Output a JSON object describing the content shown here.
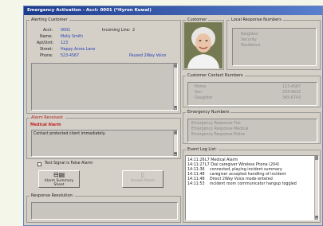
{
  "window": {
    "title": "Emergency Activation - Acct: 0001  (*Hyron Kuwal)"
  },
  "alerting_customer": {
    "label": "Alerting Customer",
    "incoming_line_label": "Incoming Line:",
    "incoming_line_value": "2",
    "fields": [
      {
        "label": "Acct:",
        "value": "0001"
      },
      {
        "label": "Name:",
        "value": "Molly Smith"
      },
      {
        "label": "Apt/Unit:",
        "value": "123"
      },
      {
        "label": "Street:",
        "value": "Happy Acres Lane"
      },
      {
        "label": "Phone:",
        "value": "523-4567"
      }
    ],
    "status": "Paused 2Way Voice"
  },
  "alarm_received": {
    "label": "Alarm Received:",
    "alarm_name": "Medical Alarm",
    "instruction": "Contact protected client immediately."
  },
  "false_alarm": {
    "label": "Test Signal is False Alarm"
  },
  "buttons": {
    "summary": "Alarm Summary Sheet",
    "accept": "Accept Alarm"
  },
  "response_resolution": {
    "label": "Response Resolution:"
  },
  "customer": {
    "label": "Customer"
  },
  "local_response": {
    "label": "Local Response Numbers",
    "items": [
      "Neighbor",
      "Security",
      "Residence"
    ]
  },
  "contact_numbers": {
    "label": "Customer Contact Numbers",
    "rows": [
      {
        "name": "Home",
        "number": "123-4567"
      },
      {
        "name": "Son",
        "number": "234-5632"
      },
      {
        "name": "Daughter",
        "number": "345-6743"
      }
    ]
  },
  "emergency_numbers": {
    "label": "Emergency Numbers",
    "items": [
      "Emergency Response Fire",
      "Emergency Response Medical",
      "Emergency Response Police"
    ]
  },
  "event_log": {
    "label": "Event Log List:",
    "entries": [
      {
        "time": "14:11:26",
        "text": "L7 Medical Alarm"
      },
      {
        "time": "14:11:27",
        "text": "L7 Dial caregiver Wireless Phone (204)"
      },
      {
        "time": "14:11:36",
        "text": "connected, playing incident summary"
      },
      {
        "time": "14:11:48",
        "text": "caregiver accepted handling of incident"
      },
      {
        "time": "14:11:48",
        "text": "Direct 2Way Voice mode entered"
      },
      {
        "time": "14:11:53",
        "text": "incident room communicator hangup toggled"
      }
    ]
  }
}
